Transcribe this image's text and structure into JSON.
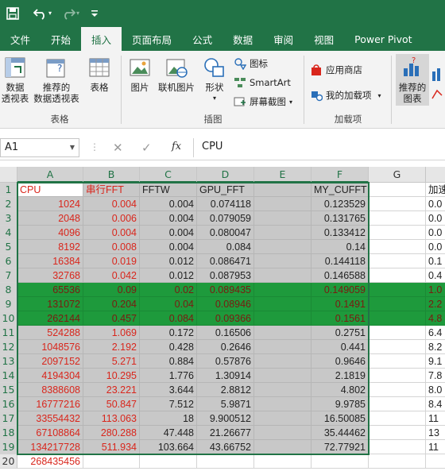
{
  "quick_access": {
    "save": "save-icon",
    "undo": "undo-icon",
    "redo": "redo-icon",
    "customize": "customize-icon"
  },
  "tabs": [
    "文件",
    "开始",
    "插入",
    "页面布局",
    "公式",
    "数据",
    "审阅",
    "视图",
    "Power Pivot"
  ],
  "active_tab": "插入",
  "ribbon": {
    "tables": {
      "label": "表格",
      "pivot": "数据\n透视表",
      "recommended_pivot": "推荐的\n数据透视表",
      "table": "表格"
    },
    "illustrations": {
      "label": "插图",
      "pictures": "图片",
      "online_pictures": "联机图片",
      "shapes": "形状",
      "icons": "图标",
      "smartart": "SmartArt",
      "screenshot": "屏幕截图"
    },
    "addins": {
      "label": "加载项",
      "store": "应用商店",
      "my_addins": "我的加载项"
    },
    "charts": {
      "recommended": "推荐的\n图表"
    }
  },
  "formula_bar": {
    "name_box": "A1",
    "cancel": "✕",
    "enter": "✓",
    "fx": "fx",
    "content": "CPU"
  },
  "columns": [
    "A",
    "B",
    "C",
    "D",
    "E",
    "F",
    "G",
    ""
  ],
  "headers": [
    "CPU",
    "串行FFT",
    "FFTW",
    "GPU_FFT",
    "",
    "MY_CUFFT",
    "",
    "加速"
  ],
  "rows": [
    [
      "1024",
      "0.004",
      "0.004",
      "0.074118",
      "",
      "0.123529",
      "",
      "0.0"
    ],
    [
      "2048",
      "0.006",
      "0.004",
      "0.079059",
      "",
      "0.131765",
      "",
      "0.0"
    ],
    [
      "4096",
      "0.004",
      "0.004",
      "0.080047",
      "",
      "0.133412",
      "",
      "0.0"
    ],
    [
      "8192",
      "0.008",
      "0.004",
      "0.084",
      "",
      "0.14",
      "",
      "0.0"
    ],
    [
      "16384",
      "0.019",
      "0.012",
      "0.086471",
      "",
      "0.144118",
      "",
      "0.1"
    ],
    [
      "32768",
      "0.042",
      "0.012",
      "0.087953",
      "",
      "0.146588",
      "",
      "0.4"
    ],
    [
      "65536",
      "0.09",
      "0.02",
      "0.089435",
      "",
      "0.149059",
      "",
      "1.0"
    ],
    [
      "131072",
      "0.204",
      "0.04",
      "0.08946",
      "",
      "0.1491",
      "",
      "2.2"
    ],
    [
      "262144",
      "0.457",
      "0.084",
      "0.09366",
      "",
      "0.1561",
      "",
      "4.8"
    ],
    [
      "524288",
      "1.069",
      "0.172",
      "0.16506",
      "",
      "0.2751",
      "",
      "6.4"
    ],
    [
      "1048576",
      "2.192",
      "0.428",
      "0.2646",
      "",
      "0.441",
      "",
      "8.2"
    ],
    [
      "2097152",
      "5.271",
      "0.884",
      "0.57876",
      "",
      "0.9646",
      "",
      "9.1"
    ],
    [
      "4194304",
      "10.295",
      "1.776",
      "1.30914",
      "",
      "2.1819",
      "",
      "7.8"
    ],
    [
      "8388608",
      "23.221",
      "3.644",
      "2.8812",
      "",
      "4.802",
      "",
      "8.0"
    ],
    [
      "16777216",
      "50.847",
      "7.512",
      "5.9871",
      "",
      "9.9785",
      "",
      "8.4"
    ],
    [
      "33554432",
      "113.063",
      "18",
      "9.900512",
      "",
      "16.50085",
      "",
      "11"
    ],
    [
      "67108864",
      "280.288",
      "47.448",
      "21.26677",
      "",
      "35.44462",
      "",
      "13"
    ],
    [
      "134217728",
      "511.934",
      "103.664",
      "43.66752",
      "",
      "72.77921",
      "",
      "11"
    ],
    [
      "268435456",
      "",
      "",
      "",
      "",
      "",
      "",
      ""
    ]
  ],
  "colors": {
    "excel_green": "#217346",
    "highlight_green": "#1e9a3c",
    "selection_gray": "#c8c8c8",
    "red_text": "#d9261c"
  }
}
